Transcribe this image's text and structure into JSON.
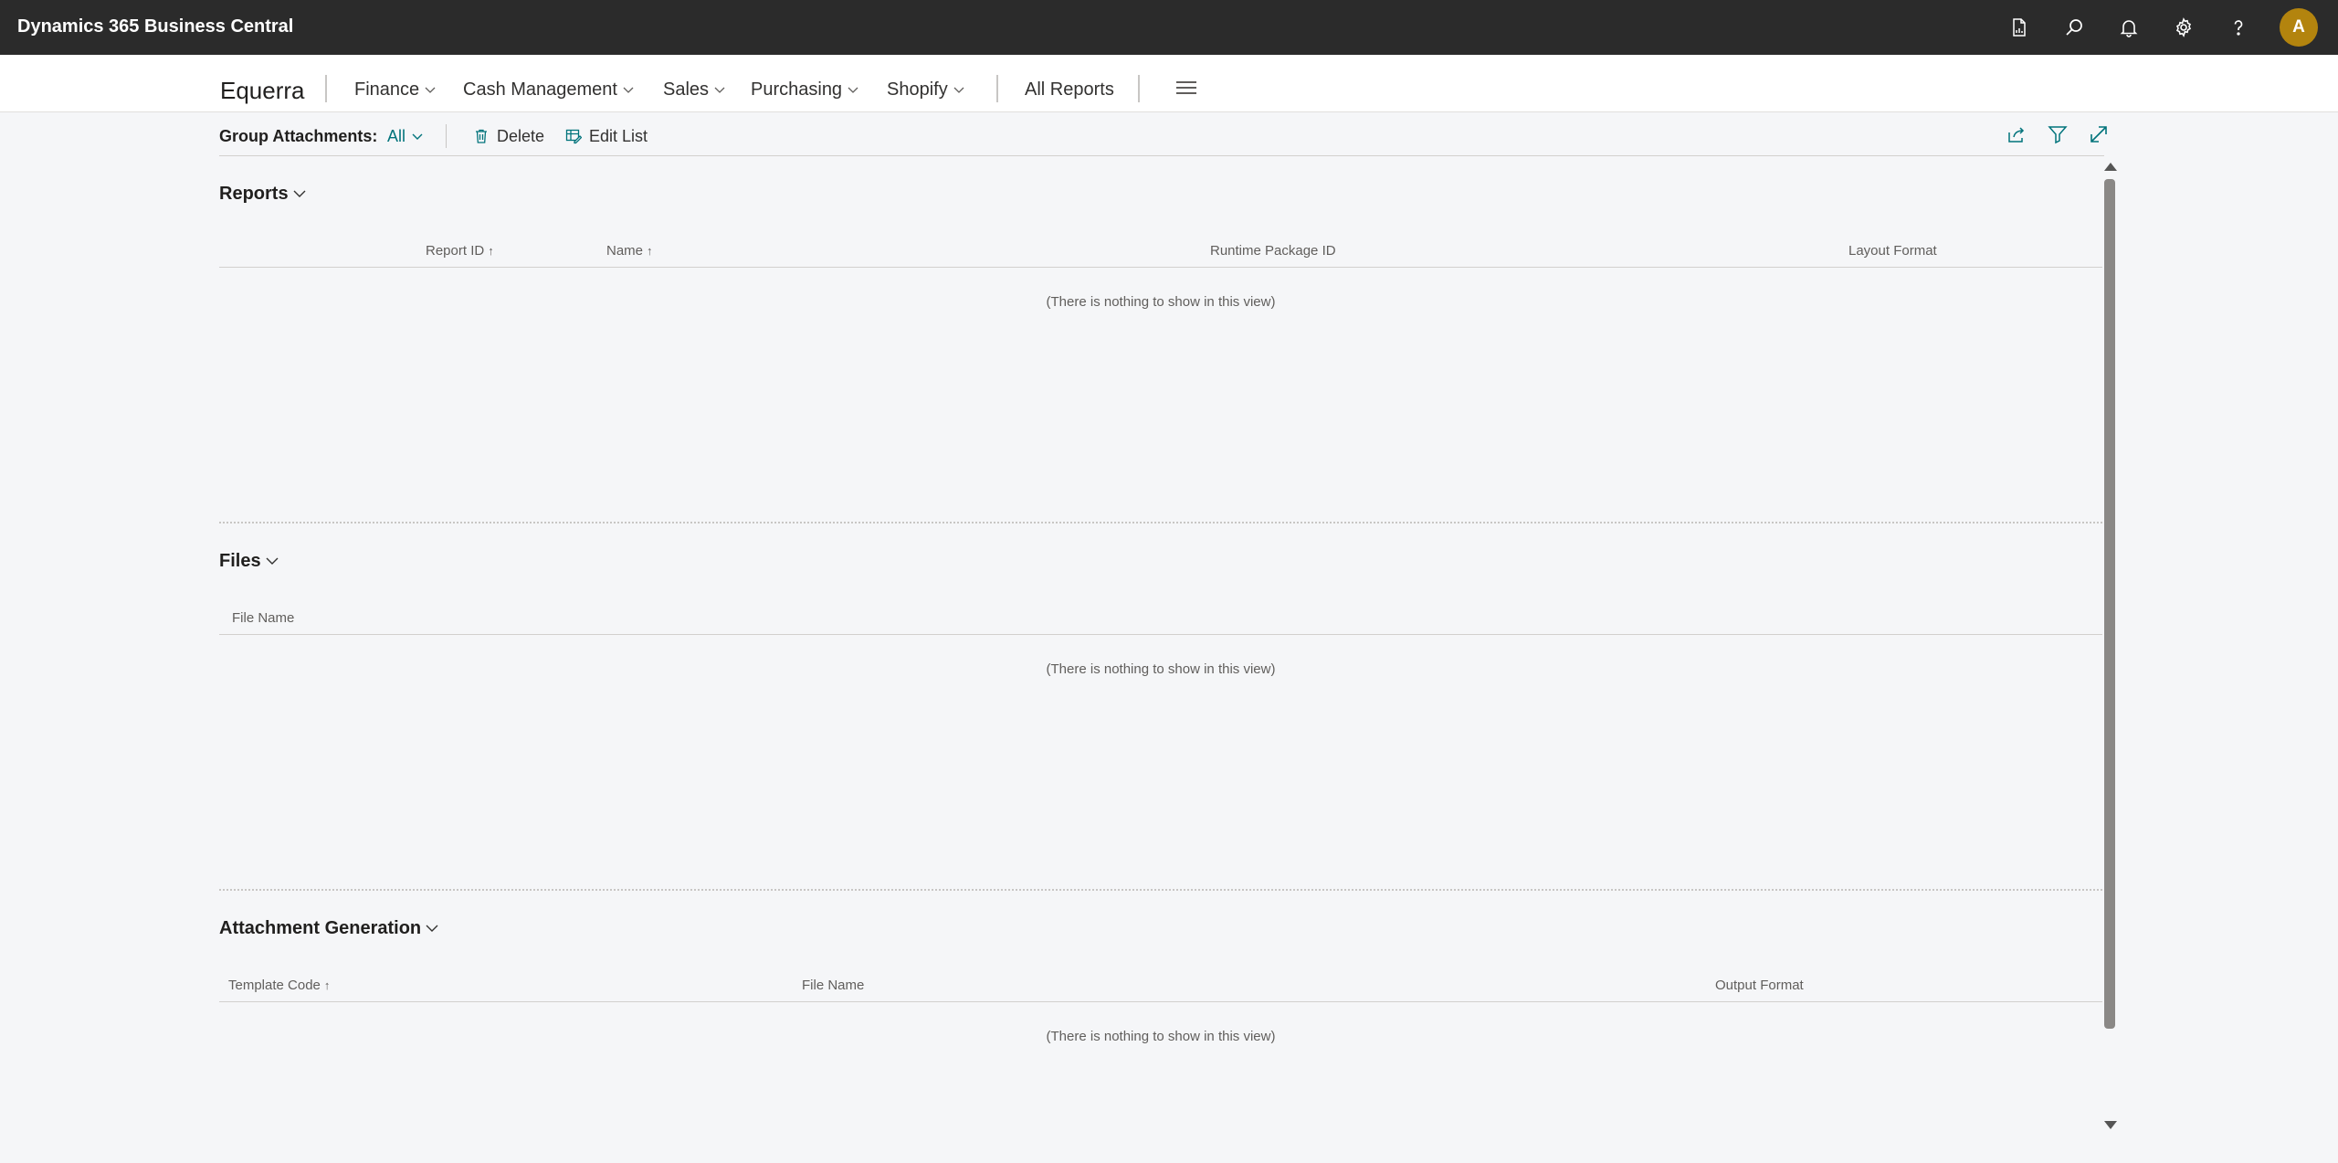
{
  "app": {
    "title": "Dynamics 365 Business Central",
    "avatar_letter": "A"
  },
  "topbar_icons": [
    "report-icon",
    "search-icon",
    "bell-icon",
    "gear-icon",
    "help-icon"
  ],
  "nav": {
    "company": "Equerra",
    "items": [
      {
        "label": "Finance",
        "has_menu": true
      },
      {
        "label": "Cash Management",
        "has_menu": true
      },
      {
        "label": "Sales",
        "has_menu": true
      },
      {
        "label": "Purchasing",
        "has_menu": true
      },
      {
        "label": "Shopify",
        "has_menu": true
      }
    ],
    "all_reports": "All Reports"
  },
  "actionbar": {
    "group_label": "Group Attachments:",
    "group_value": "All",
    "delete_label": "Delete",
    "edit_list_label": "Edit List"
  },
  "colors": {
    "accent": "#00737b",
    "appbar": "#2b2b2b",
    "avatar": "#b3840e"
  },
  "sections": {
    "reports": {
      "title": "Reports",
      "columns": [
        "Report ID",
        "Name",
        "Runtime Package ID",
        "Layout Format"
      ],
      "empty": "(There is nothing to show in this view)"
    },
    "files": {
      "title": "Files",
      "columns": [
        "File Name"
      ],
      "empty": "(There is nothing to show in this view)"
    },
    "generation": {
      "title": "Attachment Generation",
      "columns": [
        "Template Code",
        "File Name",
        "Output Format"
      ],
      "empty": "(There is nothing to show in this view)"
    }
  }
}
